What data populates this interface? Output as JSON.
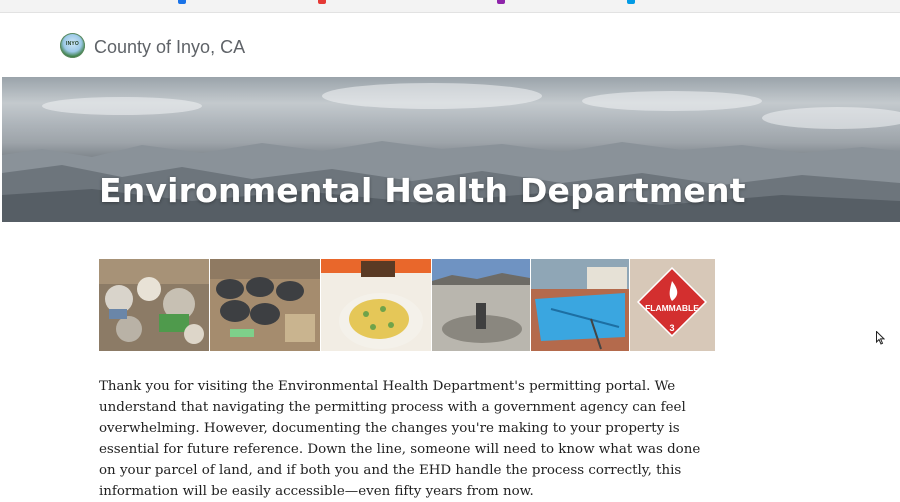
{
  "header": {
    "site_title": "County of Inyo, CA",
    "logo_text": "INYO"
  },
  "hero": {
    "title": "Environmental Health Department"
  },
  "gallery": {
    "flammable_label": "FLAMMABLE",
    "flammable_class": "3"
  },
  "content": {
    "intro": "Thank you for visiting the Environmental Health Department's permitting portal. We understand that navigating the permitting process with a government agency can feel overwhelming. However, documenting the changes you're making to your property is essential for future reference. Down the line, someone will need to know what was done on your parcel of land, and if both you and the EHD handle the process correctly, this information will be easily accessible—even fifty years from now."
  },
  "colors": {
    "site_title": "#5f6368",
    "hero_text": "#ffffff",
    "body_text": "#1f1f1f",
    "placard": "#d32f2f"
  }
}
